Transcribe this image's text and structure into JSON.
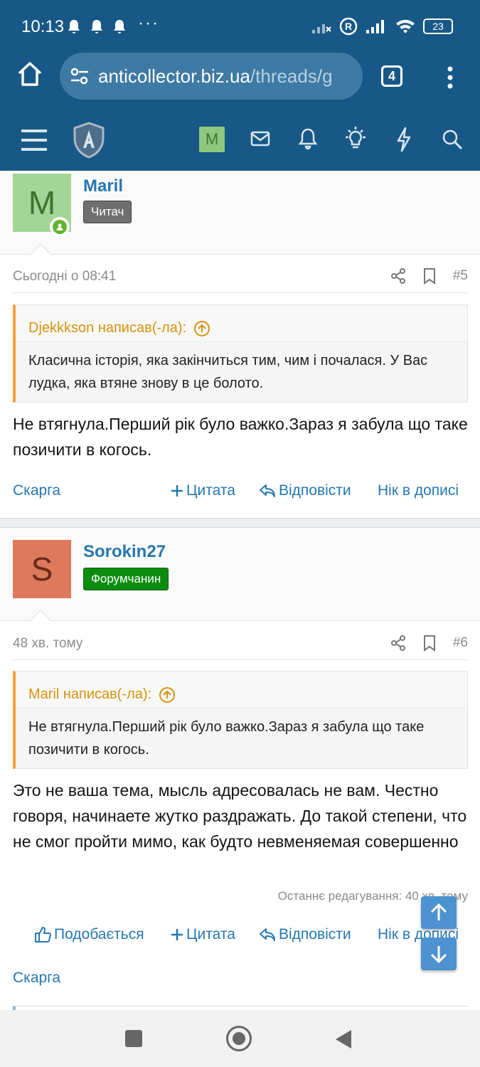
{
  "status": {
    "time": "10:13",
    "dots": "···",
    "battery": "23"
  },
  "browser": {
    "url_host": "anticollector.biz.ua",
    "url_path": "/threads/g",
    "tab_count": "4"
  },
  "forum_nav": {
    "user_initial": "M"
  },
  "posts": [
    {
      "username": "Maril",
      "avatar_letter": "M",
      "role": "Читач",
      "date": "Сьогодні о 08:41",
      "number": "#5",
      "quote_author": "Djekkkson написав(-ла):",
      "quote_text": "Класична історія, яка закінчиться тим, чим і почалася. У Вас лудка, яка втяне знову в це болото.",
      "text": "Не втягнула.Перший рік було важко.Зараз я забула що таке позичити в когось.",
      "actions": {
        "report": "Скарга",
        "quote": "Цитата",
        "reply": "Відповісти",
        "nick": "Нік в дописі"
      }
    },
    {
      "username": "Sorokin27",
      "avatar_letter": "S",
      "role": "Форумчанин",
      "date": "48 хв. тому",
      "number": "#6",
      "quote_author": "Maril написав(-ла):",
      "quote_text": "Не втягнула.Перший рік було важко.Зараз я забула що таке позичити в когось.",
      "text": "Это не ваша тема, мысль адресовалась не вам. Честно говоря, начинаете жутко раздражать. До такой степени, что не смог пройти мимо, как будто невменяемая совершенно",
      "edit_note": "Останнє редагування: 40 хв. тому",
      "actions": {
        "like": "Подобається",
        "quote": "Цитата",
        "reply": "Відповісти",
        "nick": "Нік в дописі",
        "report": "Скарга"
      }
    }
  ],
  "colors": {
    "header": "#185886",
    "link": "#2577b1",
    "quote_accent": "#f3a03c",
    "avatar_m": "#a3d597",
    "avatar_s": "#dc7a5b",
    "badge_green": "#0c8d10"
  },
  "icons": [
    "home-icon",
    "tune-icon",
    "more-vert-icon",
    "menu-icon",
    "shield-logo-icon",
    "mail-icon",
    "bell-icon",
    "bulb-icon",
    "bolt-icon",
    "search-icon",
    "share-icon",
    "bookmark-icon",
    "quote-up-icon",
    "plus-icon",
    "reply-icon",
    "thumb-up-icon",
    "arrow-up-icon",
    "arrow-down-icon"
  ]
}
